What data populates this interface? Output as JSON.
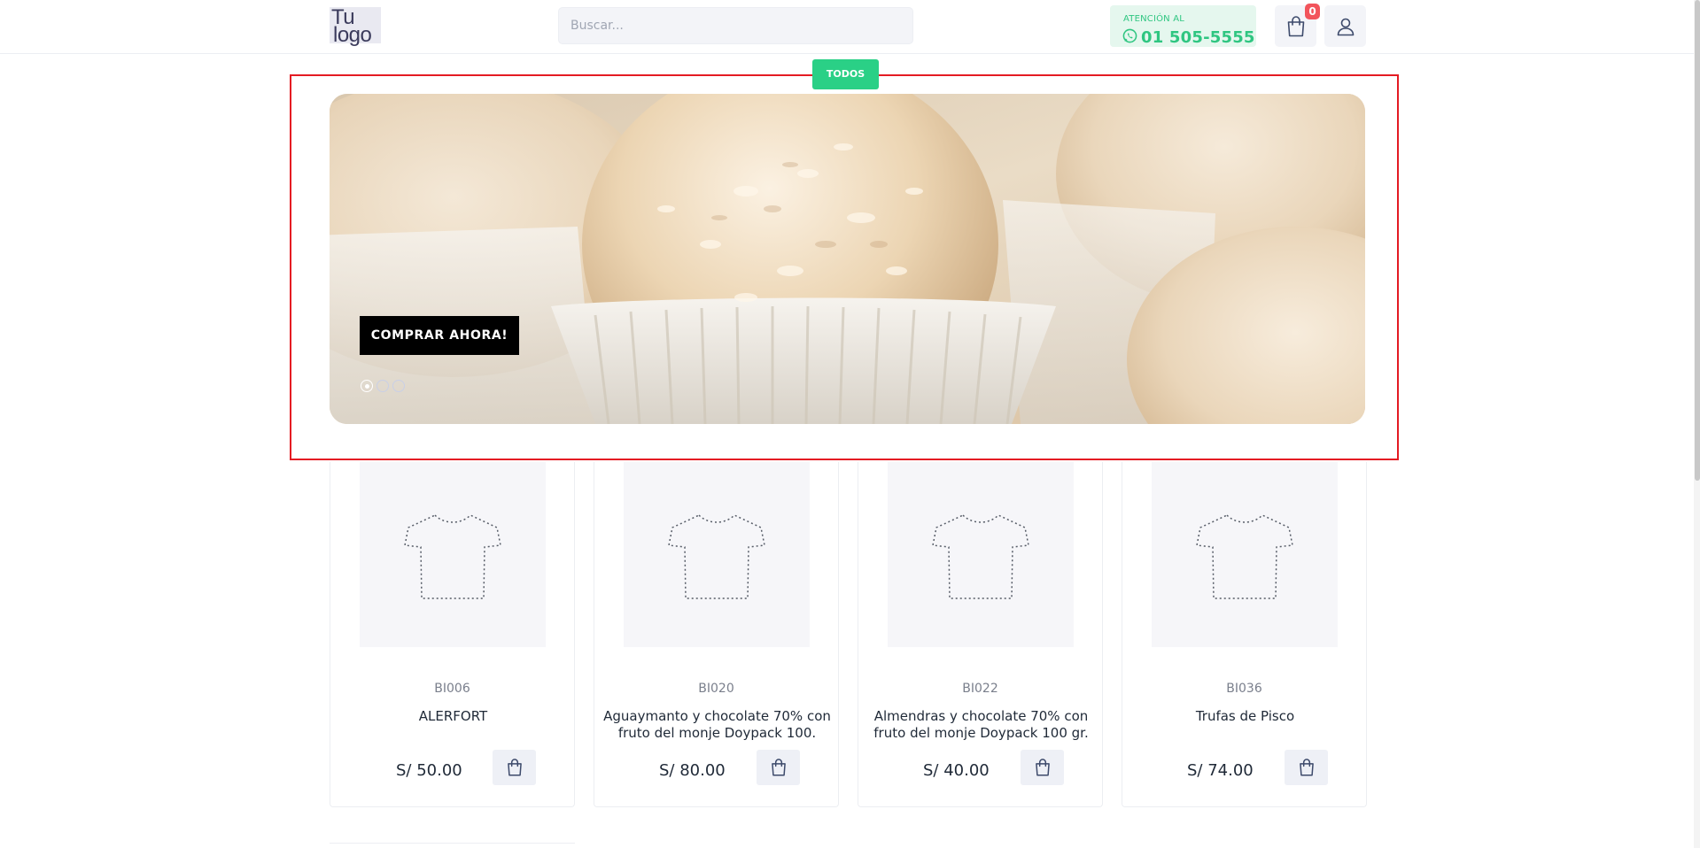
{
  "header": {
    "logo": {
      "line1": "Tu",
      "line2": "logo"
    },
    "search": {
      "placeholder": "Buscar..."
    },
    "attention": {
      "label": "ATENCIÓN AL",
      "phone": "01 505-5555",
      "icon": "whatsapp-icon"
    },
    "cart": {
      "icon": "shopping-bag-icon",
      "count": "0"
    },
    "user": {
      "icon": "user-icon"
    }
  },
  "category": {
    "label": "TODOS"
  },
  "banner": {
    "cta_label": "COMPRAR AHORA!",
    "slides": 3,
    "active_slide": 1
  },
  "products": [
    {
      "code": "BI006",
      "name": "ALERFORT",
      "price": "S/ 50.00",
      "image_icon": "tshirt-placeholder-icon",
      "cart_icon": "shopping-bag-icon"
    },
    {
      "code": "BI020",
      "name": "Aguaymanto y chocolate 70% con fruto del monje Doypack 100.",
      "price": "S/ 80.00",
      "image_icon": "tshirt-placeholder-icon",
      "cart_icon": "shopping-bag-icon"
    },
    {
      "code": "BI022",
      "name": "Almendras y chocolate 70% con fruto del monje Doypack 100 gr.",
      "price": "S/ 40.00",
      "image_icon": "tshirt-placeholder-icon",
      "cart_icon": "shopping-bag-icon"
    },
    {
      "code": "BI036",
      "name": "Trufas de Pisco",
      "price": "S/ 74.00",
      "image_icon": "tshirt-placeholder-icon",
      "cart_icon": "shopping-bag-icon"
    }
  ],
  "colors": {
    "accent": "#2ad086",
    "badge": "#f2545b",
    "highlight_border": "#e41b23",
    "cta_background": "#000000"
  }
}
